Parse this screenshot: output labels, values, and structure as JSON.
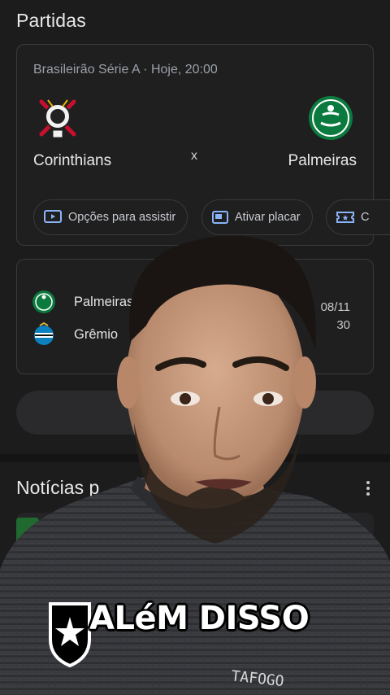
{
  "matches_section": {
    "title": "Partidas",
    "featured": {
      "league_time": "Brasileirão Série A · Hoje, 20:00",
      "home_team": "Corinthians",
      "away_team": "Palmeiras",
      "versus": "x",
      "actions": [
        {
          "label": "Opções para assistir",
          "icon": "tv-play-icon"
        },
        {
          "label": "Ativar placar",
          "icon": "scoreboard-icon"
        },
        {
          "label": "C",
          "icon": "ticket-icon"
        }
      ]
    },
    "next_match": {
      "home_team": "Palmeiras",
      "away_team": "Grêmio",
      "date": "08/11",
      "time": "30"
    }
  },
  "news_section": {
    "title": "Notícias p"
  },
  "video_caption": {
    "text": "ALéM DISSO",
    "shirt_text": "TAFOGO"
  },
  "colors": {
    "background": "#1c1c1d",
    "card_border": "#3a3a3c",
    "muted_text": "#9aa0a6",
    "palmeiras_green": "#0b7a3e",
    "corinthians_red": "#c8102e"
  }
}
